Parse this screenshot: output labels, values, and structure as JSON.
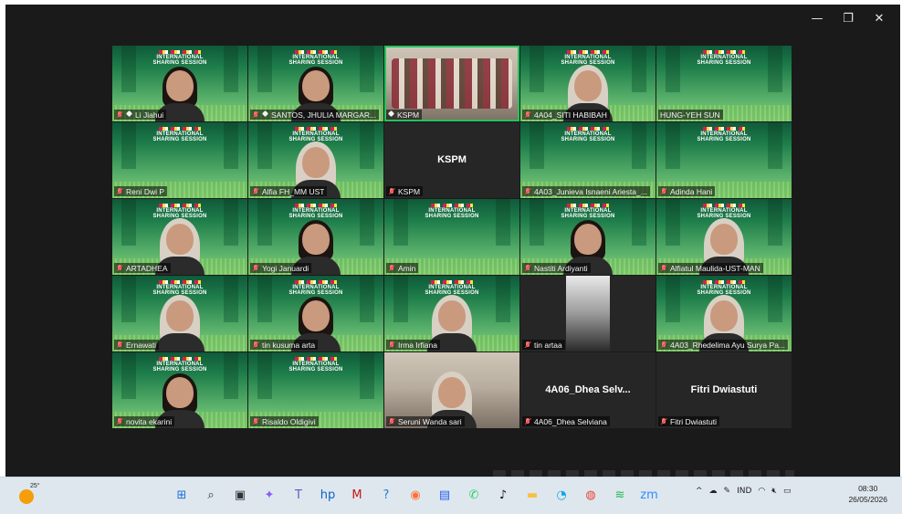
{
  "window": {
    "controls": {
      "minimize": "—",
      "maximize": "❐",
      "close": "✕"
    }
  },
  "banner": {
    "line1": "INTERNATIONAL",
    "line2": "SHARING SESSION"
  },
  "tiles": [
    {
      "name": "Li Jiahui",
      "bg": "green",
      "person": "hair",
      "pinned": true,
      "muted": true
    },
    {
      "name": "SANTOS, JHULIA MARGAR...",
      "bg": "green",
      "person": "hair",
      "pinned": true,
      "muted": true
    },
    {
      "name": "KSPM",
      "bg": "room",
      "person": "group",
      "pinned": true,
      "muted": false,
      "active": true
    },
    {
      "name": "4A04_SITI HABIBAH",
      "bg": "green",
      "person": "hijab",
      "pinned": false,
      "muted": true
    },
    {
      "name": "HUNG-YEH SUN",
      "bg": "green",
      "person": "none",
      "pinned": false,
      "muted": false
    },
    {
      "name": "Reni Dwi P",
      "bg": "green",
      "person": "none",
      "pinned": false,
      "muted": true
    },
    {
      "name": "Alfia FH_MM UST",
      "bg": "green",
      "person": "hijab",
      "pinned": false,
      "muted": true
    },
    {
      "name": "KSPM",
      "bg": "dark",
      "person": "none",
      "center": "KSPM",
      "pinned": false,
      "muted": true
    },
    {
      "name": "4A03_Junieva Isnaeni Ariesta_...",
      "bg": "green",
      "person": "none",
      "pinned": false,
      "muted": true
    },
    {
      "name": "Adinda Hani",
      "bg": "green",
      "person": "none",
      "pinned": false,
      "muted": true
    },
    {
      "name": "ARTADHEA",
      "bg": "green",
      "person": "hijab",
      "pinned": false,
      "muted": true
    },
    {
      "name": "Yogi Januardi",
      "bg": "green",
      "person": "hair",
      "pinned": false,
      "muted": true
    },
    {
      "name": "Amin",
      "bg": "green",
      "person": "none",
      "pinned": false,
      "muted": true
    },
    {
      "name": "Nastiti Ardiyanti",
      "bg": "green",
      "person": "hair",
      "pinned": false,
      "muted": true
    },
    {
      "name": "Alfiatul Maulida-UST-MAN",
      "bg": "green",
      "person": "hijab",
      "pinned": false,
      "muted": true
    },
    {
      "name": "Ernawati",
      "bg": "green",
      "person": "hijab",
      "pinned": false,
      "muted": true
    },
    {
      "name": "tin kusuma arta",
      "bg": "green",
      "person": "hair",
      "pinned": false,
      "muted": true
    },
    {
      "name": "Irma Irfiana",
      "bg": "green",
      "person": "hijab",
      "pinned": false,
      "muted": true
    },
    {
      "name": "tin artaa",
      "bg": "dark",
      "person": "portrait",
      "pinned": false,
      "muted": true
    },
    {
      "name": "4A03_Rhedelima Ayu Surya Pa...",
      "bg": "green",
      "person": "hijab",
      "pinned": false,
      "muted": true
    },
    {
      "name": "novita ekarini",
      "bg": "green",
      "person": "hair",
      "pinned": false,
      "muted": true
    },
    {
      "name": "Risaldo Oldigivi",
      "bg": "green",
      "person": "none",
      "pinned": false,
      "muted": true
    },
    {
      "name": "Seruni Wanda sari",
      "bg": "room",
      "person": "hijab",
      "pinned": false,
      "muted": true
    },
    {
      "name": "4A06_Dhea Selviana",
      "bg": "dark",
      "person": "none",
      "center": "4A06_Dhea  Selv...",
      "pinned": false,
      "muted": true
    },
    {
      "name": "Fitri Dwiastuti",
      "bg": "dark",
      "person": "none",
      "center": "Fitri Dwiastuti",
      "pinned": false,
      "muted": true
    }
  ],
  "taskbar": {
    "weather_temp": "25°",
    "apps": [
      {
        "icon": "windows-start-icon",
        "glyph": "⊞",
        "color": "#1e6fd9"
      },
      {
        "icon": "search-icon",
        "glyph": "⌕",
        "color": "#333333"
      },
      {
        "icon": "task-view-icon",
        "glyph": "▣",
        "color": "#333333"
      },
      {
        "icon": "copilot-icon",
        "glyph": "✦",
        "color": "#8b5cf6"
      },
      {
        "icon": "teams-icon",
        "glyph": "T",
        "color": "#5b5fc7"
      },
      {
        "icon": "hp-icon",
        "glyph": "hp",
        "color": "#0b63c5"
      },
      {
        "icon": "mcafee-icon",
        "glyph": "M",
        "color": "#c01818"
      },
      {
        "icon": "help-icon",
        "glyph": "?",
        "color": "#1d7fd6"
      },
      {
        "icon": "firefox-icon",
        "glyph": "◉",
        "color": "#ff7139"
      },
      {
        "icon": "store-icon",
        "glyph": "▤",
        "color": "#2563eb"
      },
      {
        "icon": "whatsapp-icon",
        "glyph": "✆",
        "color": "#25d366"
      },
      {
        "icon": "tiktok-icon",
        "glyph": "♪",
        "color": "#111111"
      },
      {
        "icon": "file-explorer-icon",
        "glyph": "▬",
        "color": "#f6c244"
      },
      {
        "icon": "edge-icon",
        "glyph": "◔",
        "color": "#0ea5e9"
      },
      {
        "icon": "chrome-icon",
        "glyph": "◍",
        "color": "#ea4335"
      },
      {
        "icon": "spotify-icon",
        "glyph": "≋",
        "color": "#1db954"
      },
      {
        "icon": "zoom-icon",
        "glyph": "zm",
        "color": "#2d8cff"
      }
    ],
    "tray": {
      "chevron": "^",
      "lang": "IND"
    },
    "clock": {
      "time": "08:30",
      "date": "26/05/2026"
    }
  }
}
